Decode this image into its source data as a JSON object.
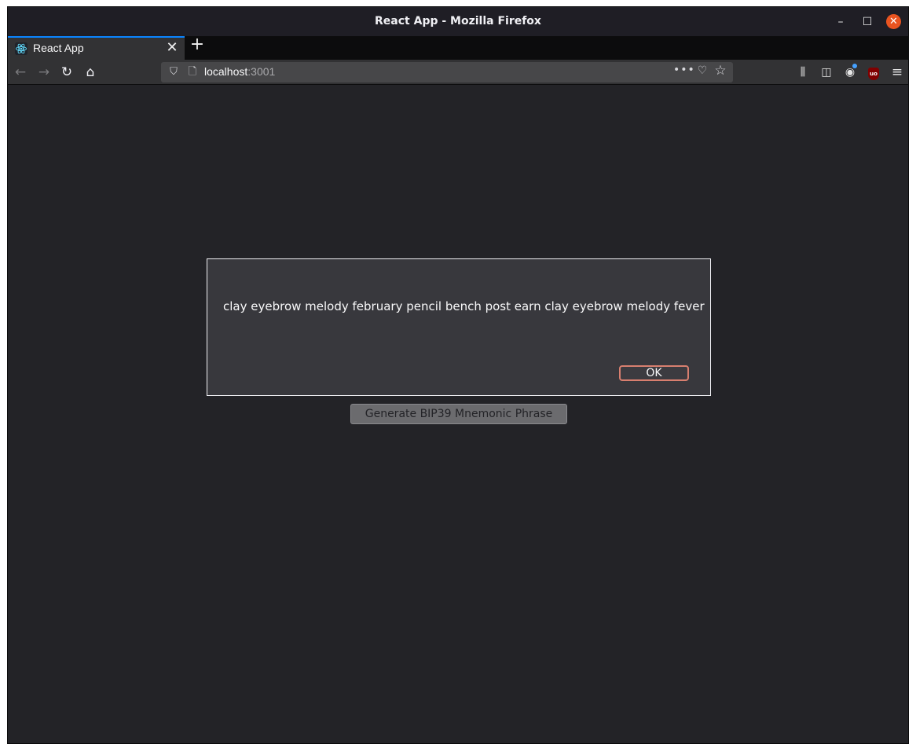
{
  "window": {
    "title": "React App - Mozilla Firefox"
  },
  "tabs": [
    {
      "label": "React App"
    }
  ],
  "navbar": {
    "url_host": "localhost",
    "url_port": ":3001"
  },
  "icons": {
    "back": "back-arrow-icon",
    "forward": "forward-arrow-icon",
    "reload": "reload-icon",
    "home": "home-icon",
    "shield": "tracking-protection-shield-icon",
    "page": "page-icon",
    "more": "more-actions-icon",
    "pocket": "pocket-icon",
    "star": "bookmark-star-icon",
    "library": "library-icon",
    "sidebar": "sidebar-icon",
    "account": "account-icon",
    "ublock": "ublock-origin-icon",
    "menu": "hamburger-menu-icon"
  },
  "ublock_text": "uo",
  "dialog": {
    "message": "clay eyebrow melody february pencil bench post earn clay eyebrow melody fever",
    "ok_label": "OK"
  },
  "main": {
    "generate_button_label": "Generate BIP39 Mnemonic Phrase"
  },
  "colors": {
    "page_background": "#232327",
    "dialog_background": "#38383d",
    "ok_border": "#d87f6f",
    "active_tab_accent": "#0a84ff",
    "close_button": "#e95420"
  }
}
